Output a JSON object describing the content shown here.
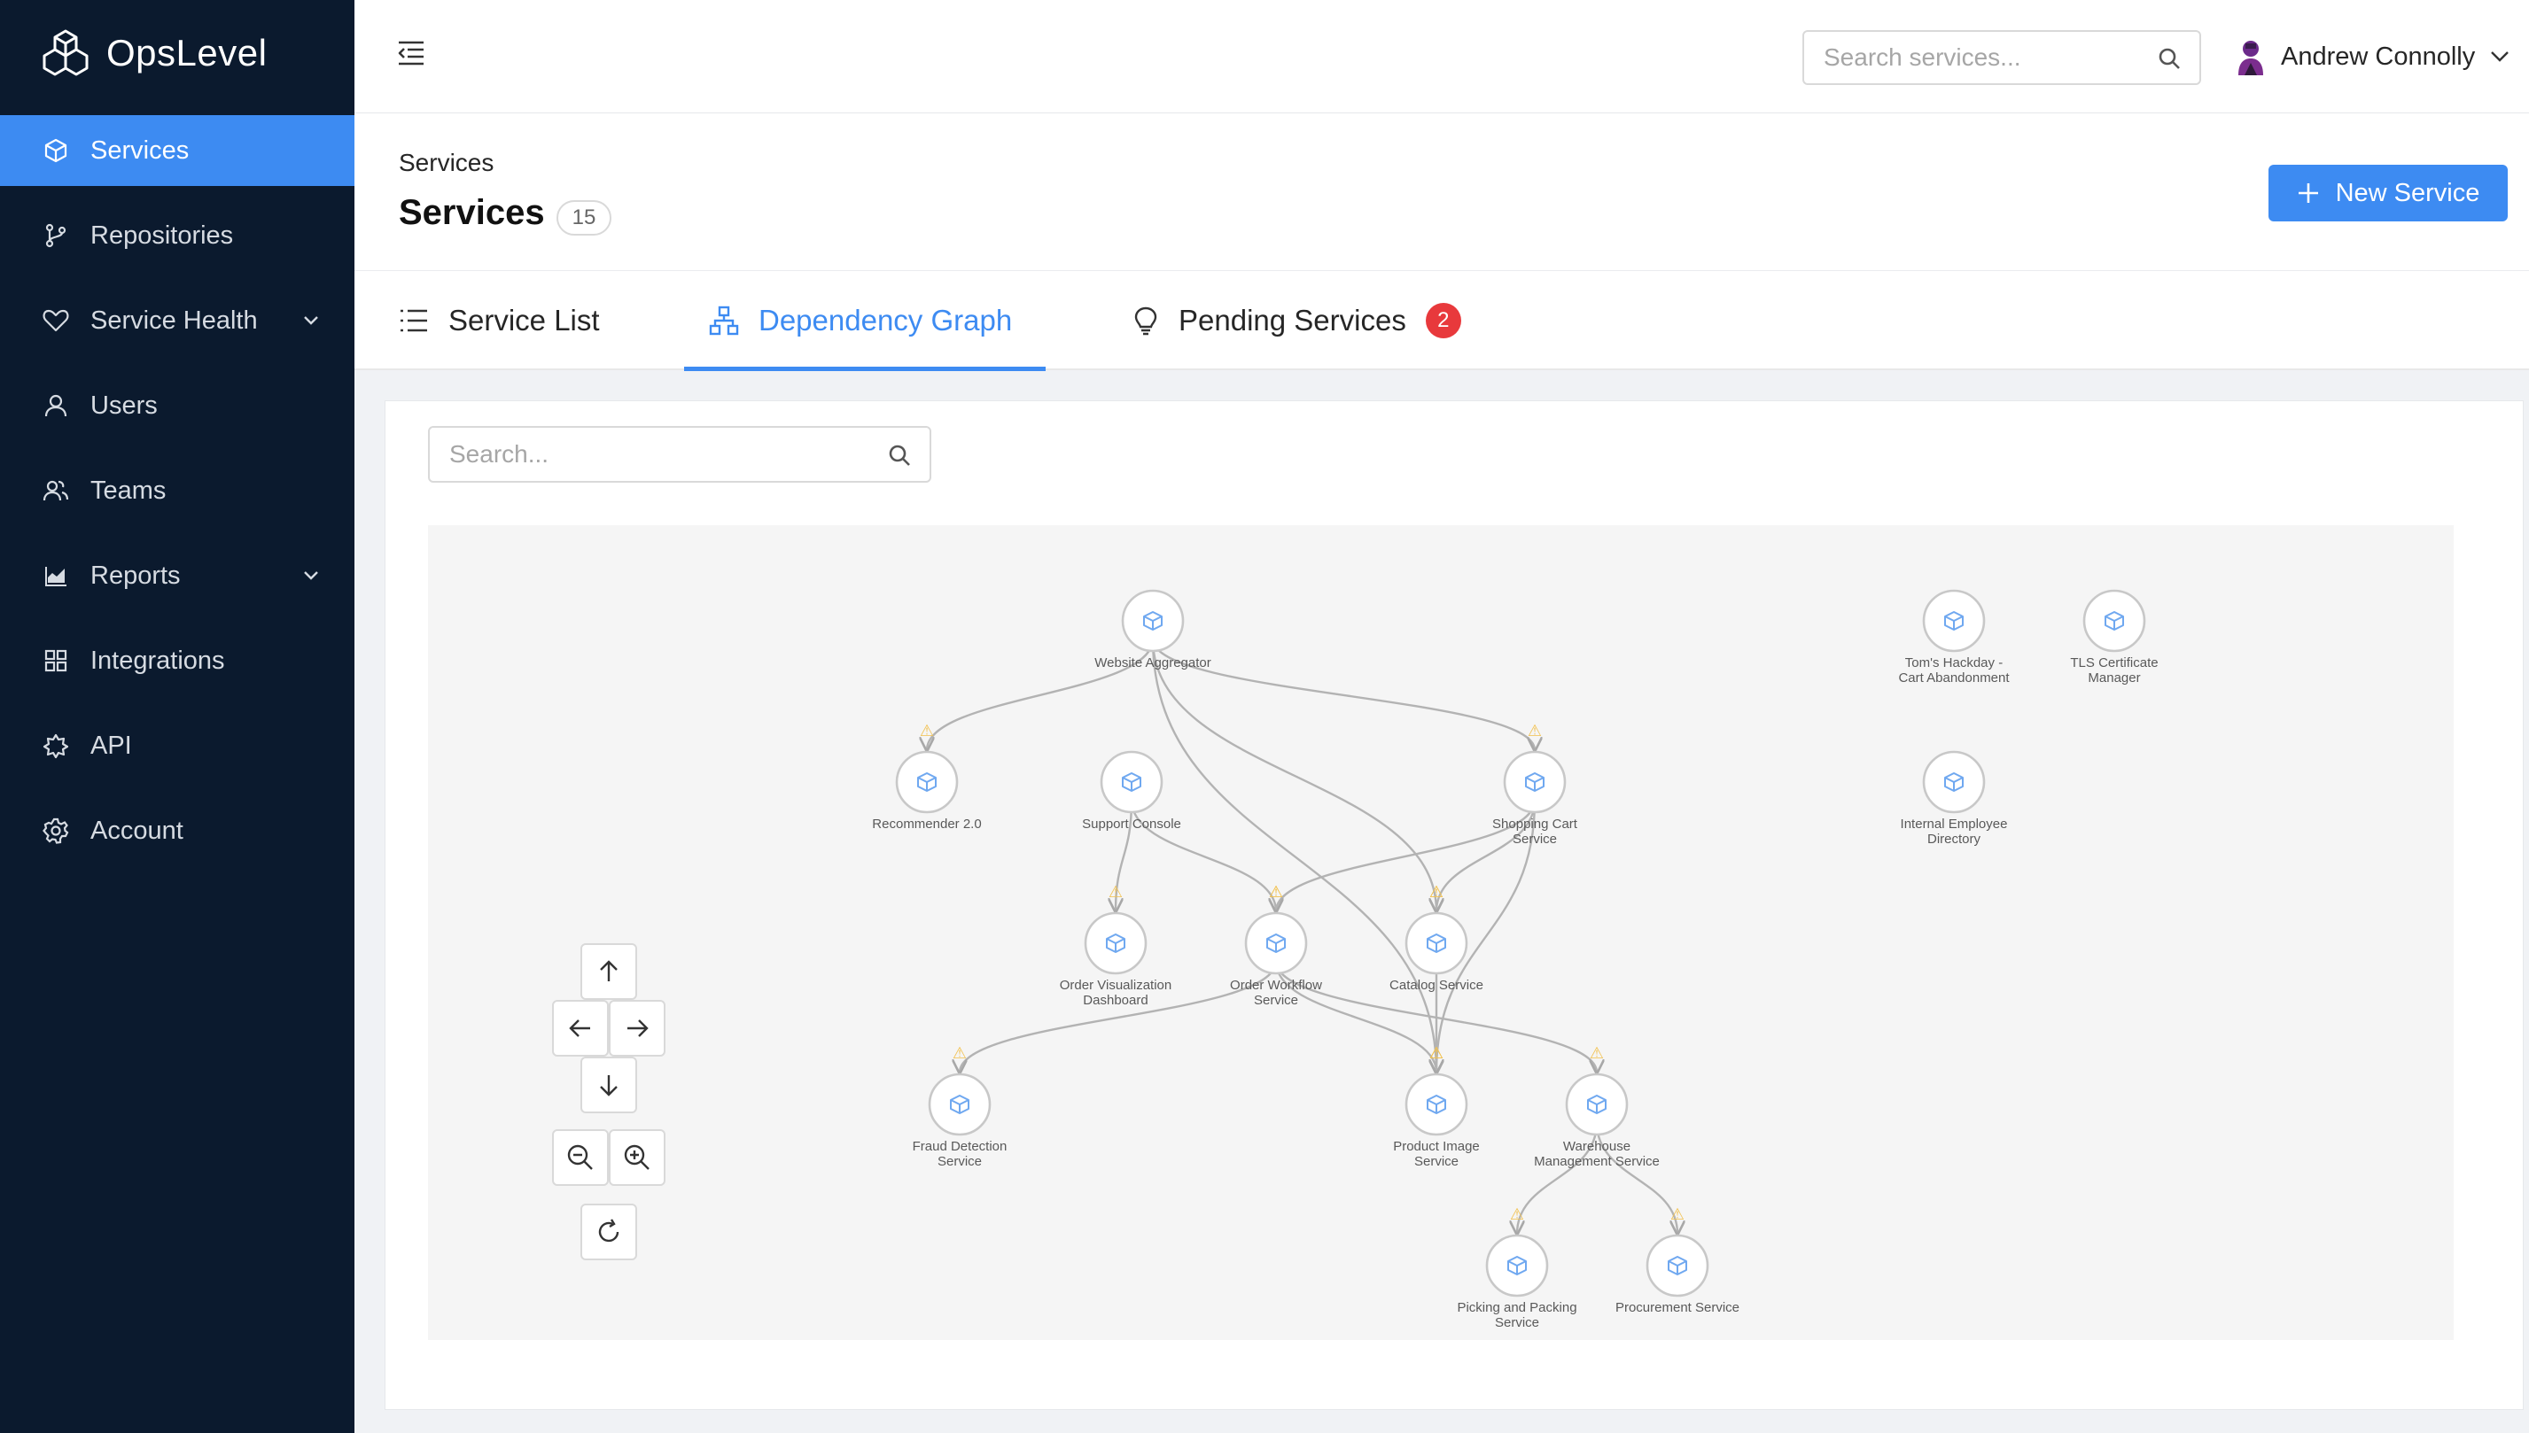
{
  "app": {
    "name": "OpsLevel"
  },
  "sidebar": {
    "items": [
      {
        "label": "Services",
        "icon": "cube-icon",
        "active": true
      },
      {
        "label": "Repositories",
        "icon": "branch-icon"
      },
      {
        "label": "Service Health",
        "icon": "heart-icon",
        "expandable": true
      },
      {
        "label": "Users",
        "icon": "user-icon"
      },
      {
        "label": "Teams",
        "icon": "team-icon"
      },
      {
        "label": "Reports",
        "icon": "chart-icon",
        "expandable": true
      },
      {
        "label": "Integrations",
        "icon": "grid-icon"
      },
      {
        "label": "API",
        "icon": "api-icon"
      },
      {
        "label": "Account",
        "icon": "gear-icon"
      }
    ]
  },
  "header": {
    "search_placeholder": "Search services...",
    "user_name": "Andrew Connolly"
  },
  "page": {
    "breadcrumb": "Services",
    "title": "Services",
    "count": "15",
    "new_button": "New Service"
  },
  "tabs": [
    {
      "label": "Service List",
      "icon": "list-icon"
    },
    {
      "label": "Dependency Graph",
      "icon": "hierarchy-icon",
      "active": true
    },
    {
      "label": "Pending Services",
      "icon": "lightbulb-icon",
      "badge": "2"
    }
  ],
  "graph": {
    "search_placeholder": "Search...",
    "nodes": [
      {
        "id": "wa",
        "label": [
          "Website Aggregator"
        ]
      },
      {
        "id": "rec",
        "label": [
          "Recommender 2.0"
        ]
      },
      {
        "id": "sc",
        "label": [
          "Support Console"
        ]
      },
      {
        "id": "shop",
        "label": [
          "Shopping Cart",
          "Service"
        ]
      },
      {
        "id": "ovd",
        "label": [
          "Order Visualization",
          "Dashboard"
        ]
      },
      {
        "id": "ows",
        "label": [
          "Order Workflow",
          "Service"
        ]
      },
      {
        "id": "cat",
        "label": [
          "Catalog Service"
        ]
      },
      {
        "id": "fraud",
        "label": [
          "Fraud Detection",
          "Service"
        ]
      },
      {
        "id": "pis",
        "label": [
          "Product Image",
          "Service"
        ]
      },
      {
        "id": "wms",
        "label": [
          "Warehouse",
          "Management Service"
        ]
      },
      {
        "id": "pps",
        "label": [
          "Picking and Packing",
          "Service"
        ]
      },
      {
        "id": "proc",
        "label": [
          "Procurement Service"
        ]
      },
      {
        "id": "tom",
        "label": [
          "Tom's Hackday -",
          "Cart Abandonment"
        ]
      },
      {
        "id": "tls",
        "label": [
          "TLS Certificate",
          "Manager"
        ]
      },
      {
        "id": "ied",
        "label": [
          "Internal Employee",
          "Directory"
        ]
      }
    ],
    "edges": [
      [
        "wa",
        "rec"
      ],
      [
        "wa",
        "shop"
      ],
      [
        "wa",
        "cat"
      ],
      [
        "wa",
        "pis"
      ],
      [
        "sc",
        "ovd"
      ],
      [
        "sc",
        "ows"
      ],
      [
        "shop",
        "ows"
      ],
      [
        "shop",
        "cat"
      ],
      [
        "shop",
        "pis"
      ],
      [
        "ows",
        "fraud"
      ],
      [
        "ows",
        "wms"
      ],
      [
        "ows",
        "pis"
      ],
      [
        "cat",
        "pis"
      ],
      [
        "wms",
        "pps"
      ],
      [
        "wms",
        "proc"
      ]
    ],
    "colors": {
      "edge": "#b3b3b3",
      "node_border": "#c8c8c8",
      "node_icon": "#6fa8f0",
      "warn": "#f2c14e"
    }
  }
}
